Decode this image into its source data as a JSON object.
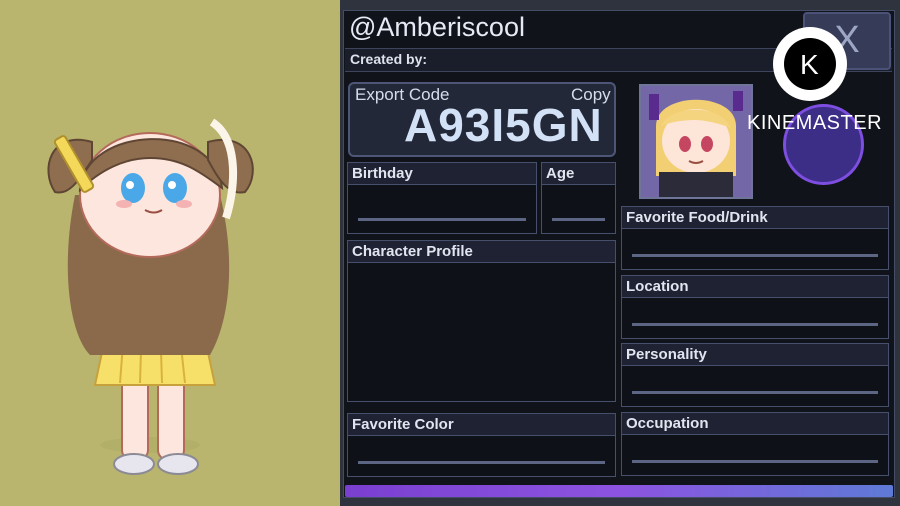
{
  "profile": {
    "username": "@Amberiscool",
    "created_by_label": "Created by:",
    "export_code_label": "Export Code",
    "copy_label": "Copy",
    "export_code": "A93I5GN",
    "close_symbol": "X"
  },
  "fields": {
    "birthday": "Birthday",
    "age": "Age",
    "character_profile": "Character Profile",
    "favorite_color": "Favorite Color",
    "favorite_food": "Favorite Food/Drink",
    "location": "Location",
    "personality": "Personality",
    "occupation": "Occupation"
  },
  "watermark": {
    "text": "KINEMASTER"
  },
  "colors": {
    "left_background": "#b9b56e",
    "panel_background": "#11131b",
    "field_border": "#46506c",
    "accent_purple": "#7a3fd0"
  },
  "icons": {
    "close": "close-icon",
    "kinemaster_logo": "kinemaster-logo-icon"
  }
}
